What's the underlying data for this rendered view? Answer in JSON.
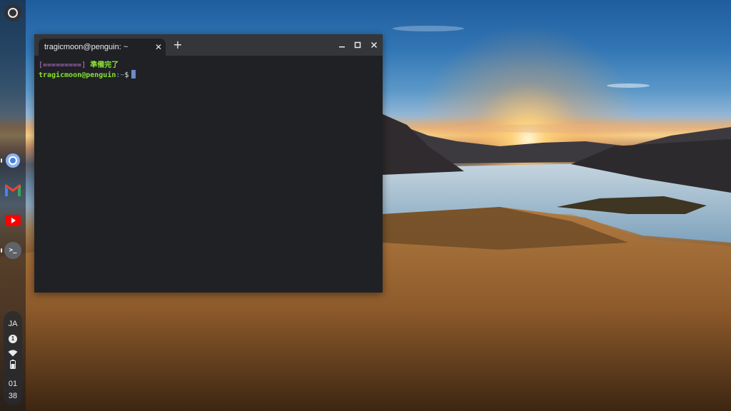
{
  "terminal": {
    "tab_title": "tragicmoon@penguin: ~",
    "close_tab_glyph": "✕",
    "new_tab_glyph": "+",
    "progress_text": "[=========]",
    "ready_text": "準備完了",
    "prompt_user": "tragicmoon@penguin",
    "prompt_path": ":~",
    "prompt_symbol": "$"
  },
  "shelf": {
    "apps": [
      {
        "icon": "chrome-icon"
      },
      {
        "icon": "gmail-icon"
      },
      {
        "icon": "youtube-icon"
      },
      {
        "icon": "terminal-icon",
        "glyph": ">_"
      }
    ]
  },
  "status": {
    "ime": "JA",
    "notifications": "1",
    "time_hour": "01",
    "time_minute": "38"
  }
}
